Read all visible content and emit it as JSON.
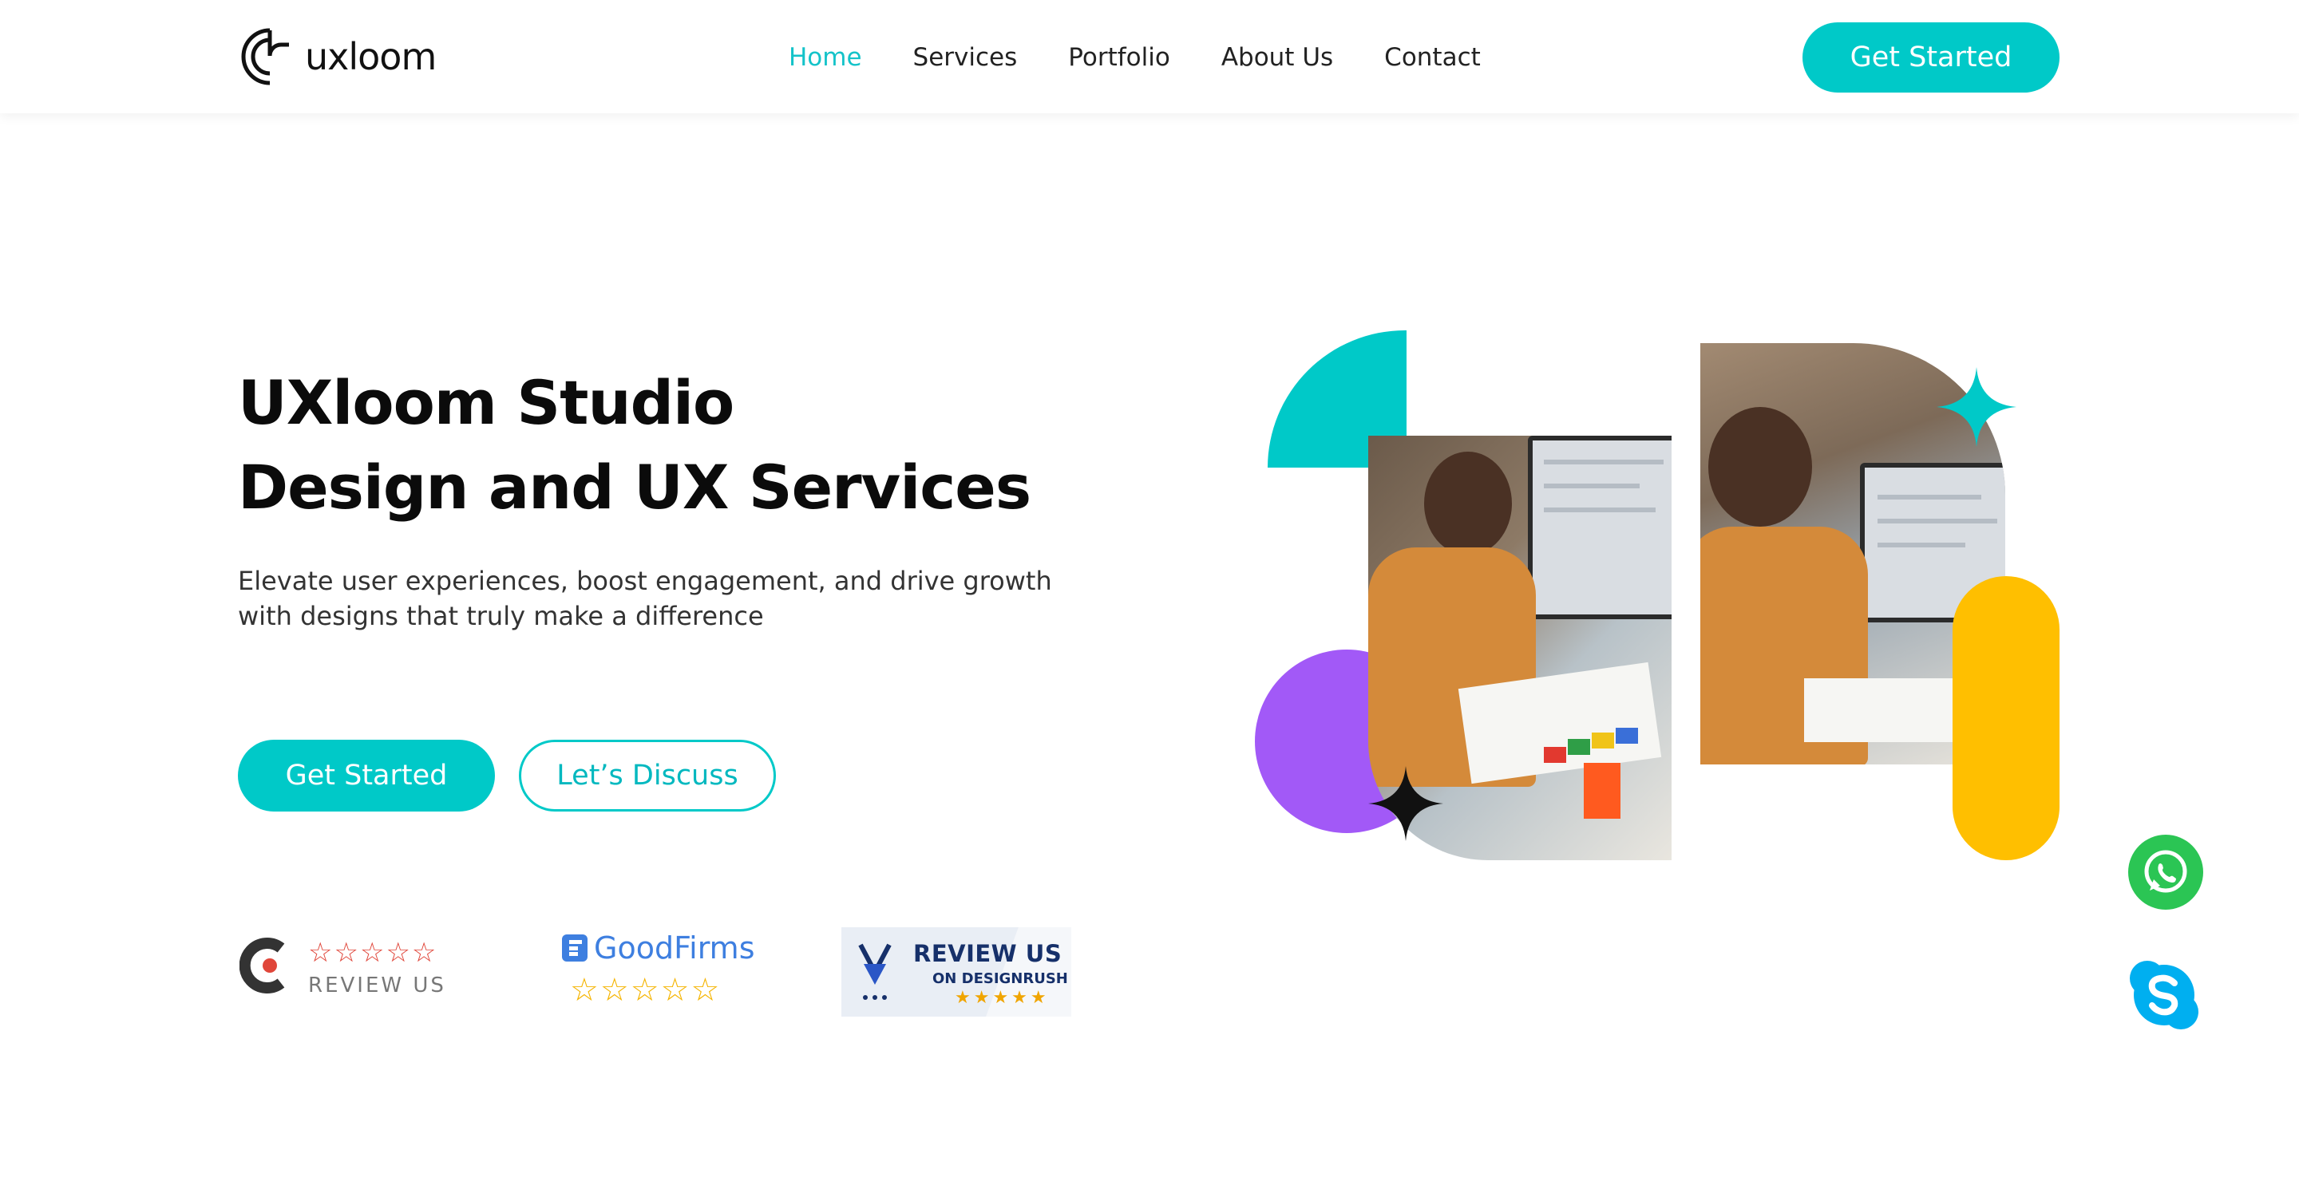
{
  "brand": {
    "name": "uxloom",
    "accent": "#00c9c8",
    "purple": "#a259f7",
    "yellow": "#ffbf00"
  },
  "nav": {
    "items": [
      {
        "label": "Home",
        "active": true
      },
      {
        "label": "Services",
        "active": false
      },
      {
        "label": "Portfolio",
        "active": false
      },
      {
        "label": "About Us",
        "active": false
      },
      {
        "label": "Contact",
        "active": false
      }
    ],
    "cta_label": "Get Started"
  },
  "hero": {
    "title_line1": "UXloom Studio",
    "title_line2": "Design and UX Services",
    "subtitle_line1": "Elevate user experiences, boost engagement, and drive growth",
    "subtitle_line2": "with designs that truly make a difference",
    "primary_button": "Get Started",
    "secondary_button": "Let’s Discuss"
  },
  "reviews": {
    "clutch": {
      "stars": "☆☆☆☆☆",
      "label": "REVIEW US",
      "icon": "clutch-logo"
    },
    "goodfirms": {
      "name": "GoodFirms",
      "stars": "☆☆☆☆☆",
      "icon": "goodfirms-logo"
    },
    "designrush": {
      "title": "REVIEW US",
      "subtitle": "ON DESIGNRUSH",
      "stars": "★★★★★",
      "icon": "designrush-shield"
    }
  },
  "floating": {
    "whatsapp_icon": "whatsapp-icon",
    "skype_icon": "skype-icon"
  }
}
